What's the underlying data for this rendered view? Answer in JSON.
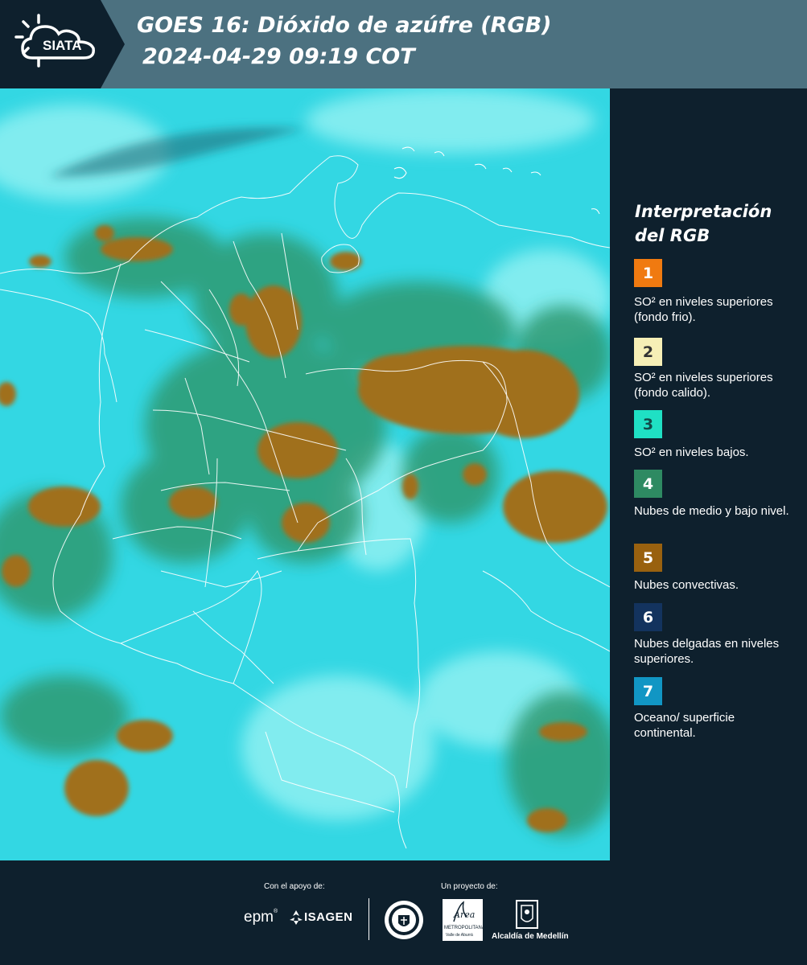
{
  "header": {
    "logo_text": "SIATA",
    "title_line1": "GOES 16: Dióxido de azúfre (RGB)",
    "title_line2": "2024-04-29 09:19 COT"
  },
  "legend": {
    "title": "Interpretación del RGB",
    "items": [
      {
        "number": "1",
        "color": "#f07a10",
        "text_color": "#ffffff",
        "label": "SO² en niveles superiores (fondo frio)."
      },
      {
        "number": "2",
        "color": "#f6efb6",
        "text_color": "#333333",
        "label": "SO² en niveles superiores (fondo calido)."
      },
      {
        "number": "3",
        "color": "#1fe0c4",
        "text_color": "#124b4a",
        "label": "SO² en niveles bajos."
      },
      {
        "number": "4",
        "color": "#2e8a62",
        "text_color": "#ffffff",
        "label": "Nubes de medio y bajo nivel."
      },
      {
        "number": "5",
        "color": "#99610f",
        "text_color": "#ffffff",
        "label": "Nubes convectivas."
      },
      {
        "number": "6",
        "color": "#13335e",
        "text_color": "#ffffff",
        "label": "Nubes delgadas en niveles superiores."
      },
      {
        "number": "7",
        "color": "#1196c4",
        "text_color": "#ffffff",
        "label": "Oceano/ superficie continental."
      }
    ]
  },
  "footer": {
    "support_label": "Con el apoyo de:",
    "project_label": "Un proyecto de:",
    "sponsor1": "epm",
    "sponsor2": "ISAGEN",
    "area_name": "Área",
    "area_subtitle": "METROPOLITANA",
    "area_subtitle2": "Valle de Aburrá",
    "alcaldia": "Alcaldía de Medellín"
  },
  "colors": {
    "header_bg": "#4c7180",
    "panel_bg": "#0e202d",
    "ocean": "#33d7e3",
    "convective": "#a0701a",
    "low_cloud": "#2f9a72"
  }
}
